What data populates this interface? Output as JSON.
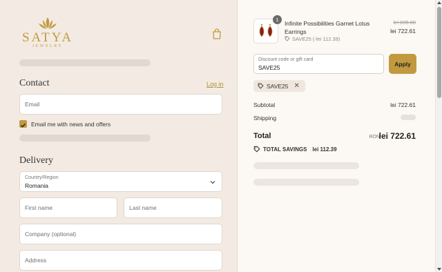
{
  "brand": {
    "name": "SATYA",
    "tagline": "JEWELRY"
  },
  "contact": {
    "heading": "Contact",
    "login_link": "Log in",
    "email_placeholder": "Email",
    "newsletter_label": "Email me with news and offers",
    "newsletter_checked": true
  },
  "delivery": {
    "heading": "Delivery",
    "country_label": "Country/Region",
    "country_value": "Romania",
    "first_name_placeholder": "First name",
    "last_name_placeholder": "Last name",
    "company_placeholder": "Company (optional)",
    "address_placeholder": "Address"
  },
  "summary": {
    "item": {
      "quantity": "1",
      "name": "Infinite Possibilities Garnet Lotus Earrings",
      "discount_line": "SAVE25 (-lei 112.39)",
      "original_price": "lei 835.00",
      "price": "lei 722.61"
    },
    "discount_field_label": "Discount code or gift card",
    "discount_field_value": "SAVE25",
    "apply_label": "Apply",
    "applied_code": "SAVE25",
    "subtotal_label": "Subtotal",
    "subtotal_value": "lei 722.61",
    "shipping_label": "Shipping",
    "total_label": "Total",
    "currency": "RON",
    "total_value": "lei 722.61",
    "savings_label": "TOTAL SAVINGS",
    "savings_value": "lei 112.39"
  },
  "colors": {
    "accent": "#c19a3f",
    "left_bg": "#f3ebe3",
    "right_bg": "#fcf8f3"
  }
}
